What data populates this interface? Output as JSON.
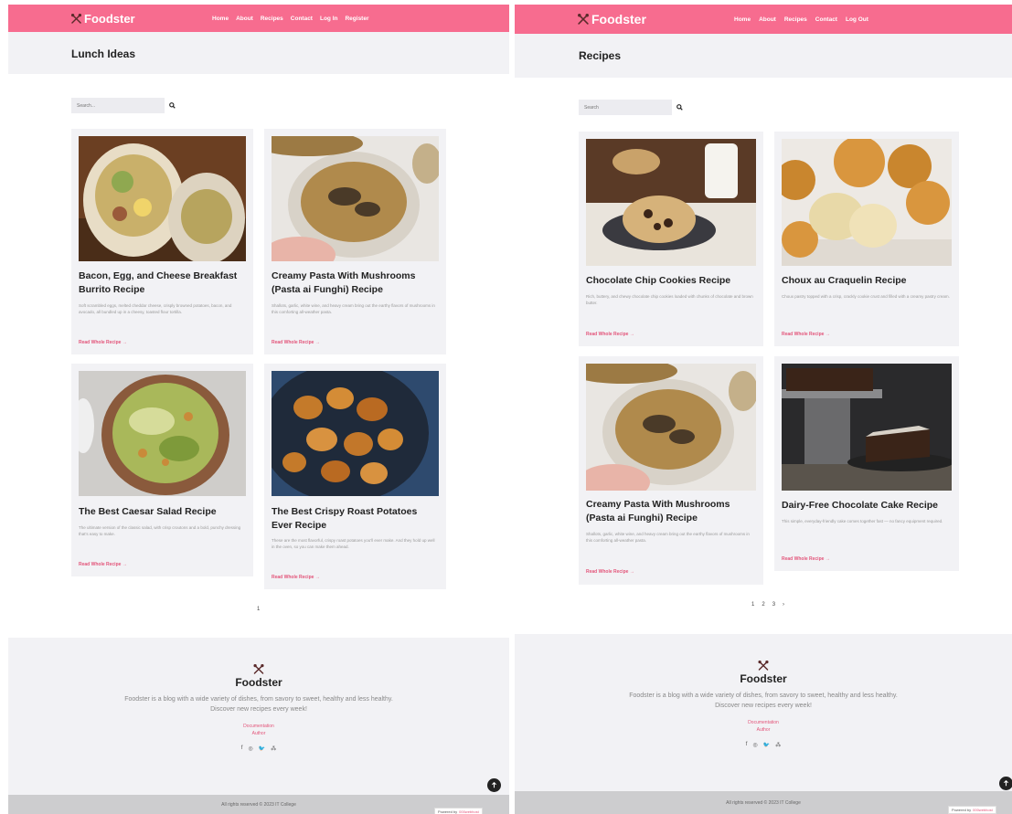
{
  "left": {
    "brand": "Foodster",
    "nav": [
      "Home",
      "About",
      "Recipes",
      "Contact",
      "Log In",
      "Register"
    ],
    "page_title": "Lunch Ideas",
    "search_placeholder": "Search...",
    "cards": [
      {
        "title": "Bacon, Egg, and Cheese Breakfast Burrito Recipe",
        "desc": "Soft scrambled eggs, melted cheddar cheese, crisply browned potatoes, bacon, and avocado, all bundled up in a cheesy, toasted flour tortilla.",
        "link": "Read Whole Recipe →"
      },
      {
        "title": "Creamy Pasta With Mushrooms (Pasta ai Funghi) Recipe",
        "desc": "Shallots, garlic, white wine, and heavy cream bring out the earthy flavors of mushrooms in this comforting all-weather pasta.",
        "link": "Read Whole Recipe →"
      },
      {
        "title": "The Best Caesar Salad Recipe",
        "desc": "The ultimate version of the classic salad, with crisp croutons and a bold, punchy dressing that's easy to make.",
        "link": "Read Whole Recipe →"
      },
      {
        "title": "The Best Crispy Roast Potatoes Ever Recipe",
        "desc": "These are the most flavorful, crispy roast potatoes you'll ever make. And they hold up well in the oven, so you can make them ahead.",
        "link": "Read Whole Recipe →"
      }
    ],
    "pages": [
      "1"
    ],
    "footer": {
      "brand": "Foodster",
      "text": "Foodster is a blog with a wide variety of dishes, from savory to sweet, healthy and less healthy. Discover new recipes every week!",
      "links": [
        "Documentation",
        "Author"
      ],
      "social": [
        "f",
        "◎",
        "🐦",
        "⁂"
      ],
      "copyright": "All rights reserved © 2023 IT College"
    }
  },
  "right": {
    "brand": "Foodster",
    "nav": [
      "Home",
      "About",
      "Recipes",
      "Contact",
      "Log Out"
    ],
    "page_title": "Recipes",
    "search_placeholder": "Search",
    "cards": [
      {
        "title": "Chocolate Chip Cookies Recipe",
        "desc": "Rich, buttery, and chewy chocolate chip cookies loaded with chunks of chocolate and brown butter.",
        "link": "Read Whole Recipe →"
      },
      {
        "title": "Choux au Craquelin Recipe",
        "desc": "Choux pastry topped with a crisp, crackly cookie crust and filled with a creamy pastry cream.",
        "link": "Read Whole Recipe →"
      },
      {
        "title": "Creamy Pasta With Mushrooms (Pasta ai Funghi) Recipe",
        "desc": "Shallots, garlic, white wine, and heavy cream bring out the earthy flavors of mushrooms in this comforting all-weather pasta.",
        "link": "Read Whole Recipe →"
      },
      {
        "title": "Dairy-Free Chocolate Cake Recipe",
        "desc": "This simple, everyday-friendly cake comes together fast — no fancy equipment required.",
        "link": "Read Whole Recipe →"
      }
    ],
    "pages": [
      "1",
      "2",
      "3",
      "›"
    ],
    "footer": {
      "brand": "Foodster",
      "text": "Foodster is a blog with a wide variety of dishes, from savory to sweet, healthy and less healthy. Discover new recipes every week!",
      "links": [
        "Documentation",
        "Author"
      ],
      "social": [
        "f",
        "◎",
        "🐦",
        "⁂"
      ],
      "copyright": "All rights reserved © 2023 IT College"
    }
  },
  "powered_by": "Powered by",
  "powered_brand": "000webhost",
  "icons": {
    "search": "search-icon",
    "logo": "utensils-icon",
    "top": "arrow-up-icon"
  },
  "colors": {
    "accent": "#f76c8f",
    "link": "#e3557a",
    "panel": "#f2f2f5"
  }
}
